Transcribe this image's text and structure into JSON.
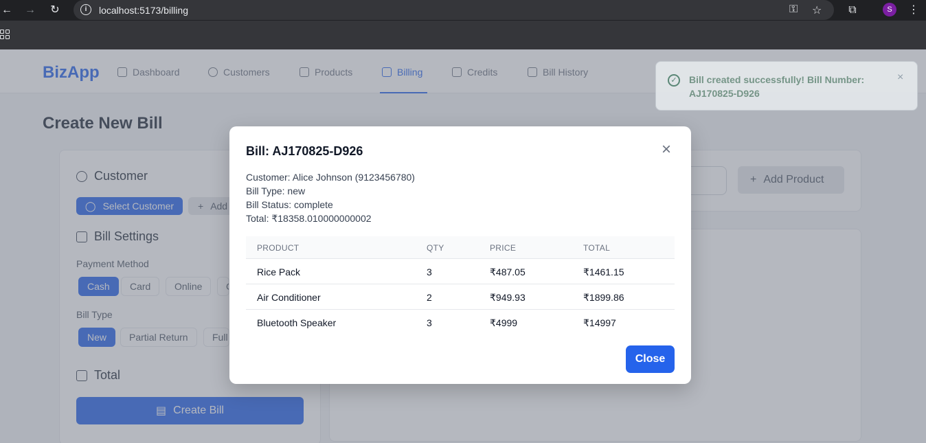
{
  "browser": {
    "url": "localhost:5173/billing",
    "profile_initial": "S"
  },
  "nav": {
    "brand": "BizApp",
    "items": [
      {
        "label": "Dashboard"
      },
      {
        "label": "Customers"
      },
      {
        "label": "Products"
      },
      {
        "label": "Billing"
      },
      {
        "label": "Credits"
      },
      {
        "label": "Bill History"
      }
    ],
    "active": "Billing"
  },
  "page": {
    "title": "Create New Bill",
    "customer": {
      "title": "Customer",
      "select_label": "Select Customer",
      "add_label": "Add"
    },
    "settings": {
      "title": "Bill Settings",
      "payment_label": "Payment Method",
      "payment_options": [
        "Cash",
        "Card",
        "Online",
        "C"
      ],
      "payment_selected": "Cash",
      "type_label": "Bill Type",
      "type_options": [
        "New",
        "Partial Return",
        "Full"
      ],
      "type_selected": "New"
    },
    "total": {
      "title": "Total",
      "create_label": "Create Bill"
    },
    "add_product_label": "Add Product"
  },
  "toast": {
    "message": "Bill created successfully! Bill Number: AJ170825-D926",
    "close": "×"
  },
  "modal": {
    "title": "Bill: AJ170825-D926",
    "customer": "Customer: Alice Johnson (9123456780)",
    "bill_type": "Bill Type: new",
    "bill_status": "Bill Status: complete",
    "total": "Total: ₹18358.010000000002",
    "columns": [
      "PRODUCT",
      "QTY",
      "PRICE",
      "TOTAL"
    ],
    "rows": [
      {
        "product": "Rice Pack",
        "qty": "3",
        "price": "₹487.05",
        "total": "₹1461.15"
      },
      {
        "product": "Air Conditioner",
        "qty": "2",
        "price": "₹949.93",
        "total": "₹1899.86"
      },
      {
        "product": "Bluetooth Speaker",
        "qty": "3",
        "price": "₹4999",
        "total": "₹14997"
      }
    ],
    "close_label": "Close",
    "close_icon": "×"
  }
}
